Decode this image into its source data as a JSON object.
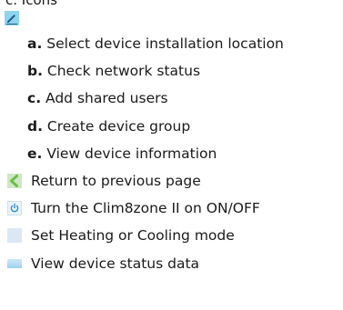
{
  "heading": "c. Icons",
  "colors": {
    "edit_icon_bg": "#8fd4ee",
    "back_icon_fill": "#6cbf4a",
    "power_icon": "#2d8fcf"
  },
  "edit_icon": "pencil-edit-icon",
  "sub_items": [
    {
      "letter": "a.",
      "text": " Select device installation location"
    },
    {
      "letter": "b.",
      "text": " Check network status"
    },
    {
      "letter": "c.",
      "text": " Add shared users"
    },
    {
      "letter": "d.",
      "text": " Create device group"
    },
    {
      "letter": "e.",
      "text": " View device information"
    }
  ],
  "icon_items": [
    {
      "icon": "back-arrow-icon",
      "text": "Return to previous page"
    },
    {
      "icon": "power-icon",
      "text": "Turn the Clim8zone II on ON/OFF"
    },
    {
      "icon": "mode-icon",
      "text": "Set Heating or Cooling mode"
    },
    {
      "icon": "status-data-icon",
      "text": "View device status data"
    }
  ]
}
